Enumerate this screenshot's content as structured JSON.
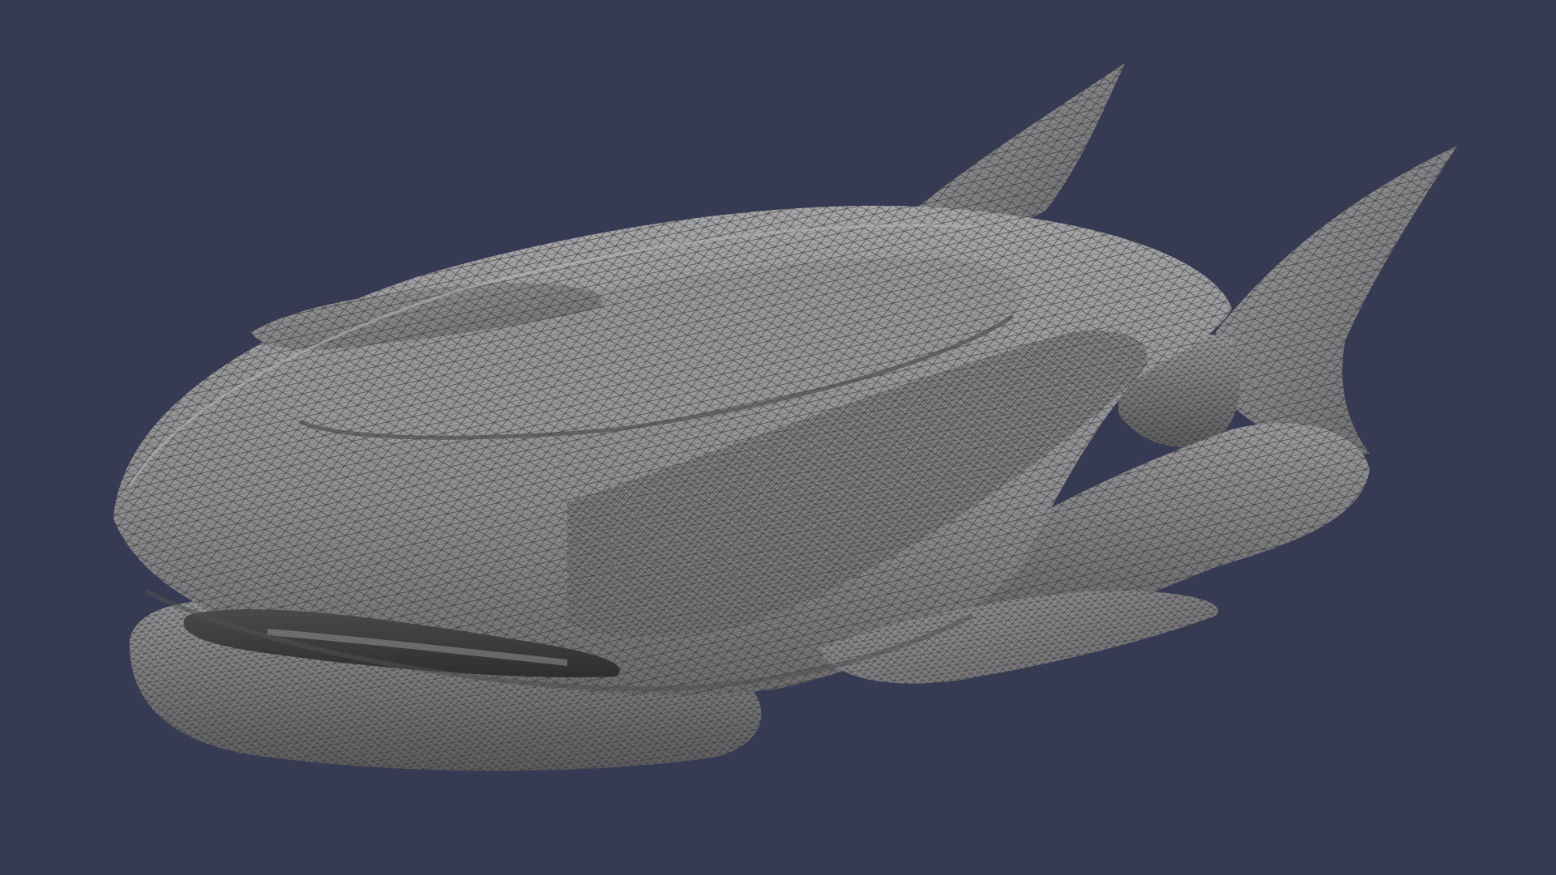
{
  "viewport": {
    "background_color": "#363a52",
    "model_base_color": "#8a8a8c",
    "model_highlight_color": "#a2a2a4",
    "model_shadow_color": "#555557",
    "wireframe_color": "#2c2c2e",
    "display_mode": "shaded-with-wireframe"
  }
}
